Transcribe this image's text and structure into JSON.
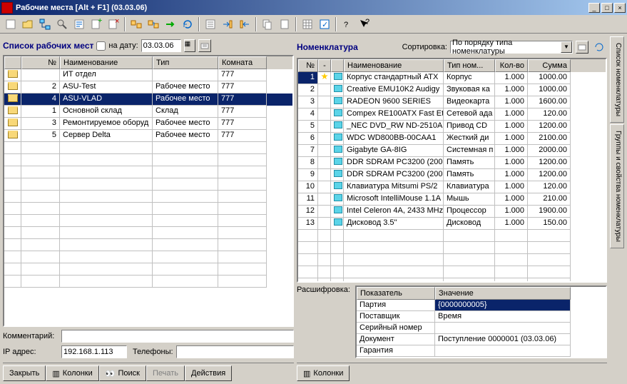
{
  "window": {
    "title": "Рабочие места [Alt + F1] (03.03.06)"
  },
  "left": {
    "title": "Список рабочих мест",
    "date_check_label": "на дату:",
    "date_value": "03.03.06",
    "columns": {
      "num": "№",
      "name": "Наименование",
      "type": "Тип",
      "room": "Комната"
    },
    "rows": [
      {
        "num": "",
        "name": "ИТ отдел",
        "type": "",
        "room": "777"
      },
      {
        "num": "2",
        "name": "ASU-Test",
        "type": "Рабочее место",
        "room": "777"
      },
      {
        "num": "4",
        "name": "ASU-VLAD",
        "type": "Рабочее место",
        "room": "777",
        "selected": true
      },
      {
        "num": "1",
        "name": "Основной склад",
        "type": "Склад",
        "room": "777"
      },
      {
        "num": "3",
        "name": "Ремонтируемое оборуд",
        "type": "Рабочее место",
        "room": "777"
      },
      {
        "num": "5",
        "name": "Сервер Delta",
        "type": "Рабочее место",
        "room": "777"
      }
    ],
    "comment_label": "Комментарий:",
    "ip_label": "IP адрес:",
    "ip_value": "192.168.1.113",
    "phones_label": "Телефоны:",
    "buttons": {
      "close": "Закрыть",
      "columns": "Колонки",
      "search": "Поиск",
      "print": "Печать",
      "actions": "Действия"
    }
  },
  "right": {
    "title": "Номенклатура",
    "sort_label": "Сортировка:",
    "sort_value": "По порядку типа номенклатуры",
    "columns": {
      "num": "№",
      "flag": "-",
      "name": "Наименование",
      "type": "Тип ном...",
      "qty": "Кол-во",
      "sum": "Сумма"
    },
    "rows": [
      {
        "num": "1",
        "flag": true,
        "name": "Корпус стандартный ATX",
        "type": "Корпус",
        "qty": "1.000",
        "sum": "1000.00",
        "selected": true
      },
      {
        "num": "2",
        "name": "Creative EMU10K2 Audigy",
        "type": "Звуковая ка",
        "qty": "1.000",
        "sum": "1000.00"
      },
      {
        "num": "3",
        "name": "RADEON 9600 SERIES",
        "type": "Видеокарта",
        "qty": "1.000",
        "sum": "1600.00"
      },
      {
        "num": "4",
        "name": "Compex RE100ATX Fast Et",
        "type": "Сетевой ада",
        "qty": "1.000",
        "sum": "120.00"
      },
      {
        "num": "5",
        "name": "_NEC DVD_RW ND-2510A",
        "type": "Привод CD",
        "qty": "1.000",
        "sum": "1200.00"
      },
      {
        "num": "6",
        "name": "WDC WD800BB-00CAA1",
        "type": "Жесткий ди",
        "qty": "1.000",
        "sum": "2100.00"
      },
      {
        "num": "7",
        "name": "Gigabyte GA-8IG",
        "type": "Системная п",
        "qty": "1.000",
        "sum": "2000.00"
      },
      {
        "num": "8",
        "name": "DDR SDRAM PC3200 (200",
        "type": "Память",
        "qty": "1.000",
        "sum": "1200.00"
      },
      {
        "num": "9",
        "name": "DDR SDRAM PC3200 (200",
        "type": "Память",
        "qty": "1.000",
        "sum": "1200.00"
      },
      {
        "num": "10",
        "name": "Клавиатура Mitsumi PS/2",
        "type": "Клавиатура",
        "qty": "1.000",
        "sum": "120.00"
      },
      {
        "num": "11",
        "name": "Microsoft IntelliMouse 1.1A",
        "type": "Мышь",
        "qty": "1.000",
        "sum": "210.00"
      },
      {
        "num": "12",
        "name": "Intel Celeron 4A, 2433 MHz",
        "type": "Процессор",
        "qty": "1.000",
        "sum": "1900.00"
      },
      {
        "num": "13",
        "name": "Дисковод 3.5''",
        "type": "Дисковод",
        "qty": "1.000",
        "sum": "150.00"
      }
    ],
    "detail_label": "Расшифровка:",
    "detail_columns": {
      "key": "Показатель",
      "val": "Значение"
    },
    "details": [
      {
        "key": "Партия",
        "val": "{0000000005}",
        "selected": true
      },
      {
        "key": "Поставщик",
        "val": "Время"
      },
      {
        "key": "Серийный номер",
        "val": ""
      },
      {
        "key": "Документ",
        "val": "Поступление 0000001 (03.03.06)"
      },
      {
        "key": "Гарантия",
        "val": ""
      }
    ],
    "columns_btn": "Колонки"
  },
  "side_tabs": {
    "tab1": "Список номенклатуры",
    "tab2": "Группы и свойства номенклатуры"
  }
}
